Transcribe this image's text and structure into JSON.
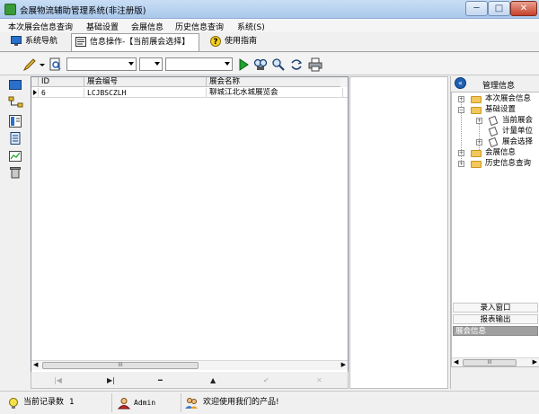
{
  "window": {
    "title": "会展物流辅助管理系统(非注册版)",
    "min": "─",
    "max": "□",
    "close": "✕"
  },
  "menu": [
    "本次展会信息查询",
    "基础设置",
    "会展信息",
    "历史信息查询",
    "系统(S)"
  ],
  "tabs": [
    {
      "label": "系统导航",
      "icon": "monitor-icon"
    },
    {
      "label": "信息操作-【当前展会选择】",
      "icon": "document-icon"
    },
    {
      "label": "使用指南",
      "icon": "help-icon"
    }
  ],
  "toolbar": {
    "icons": [
      "pencil-icon",
      "search-doc-icon",
      "play-icon",
      "find-icon",
      "find-next-icon",
      "replace-icon",
      "print-icon"
    ],
    "combo1": "",
    "combo2": "",
    "combo3": ""
  },
  "grid": {
    "columns": [
      "ID",
      "展会编号",
      "展会名称"
    ],
    "rows": [
      {
        "id": "6",
        "code": "LCJBSCZLH",
        "name": "聊城江北水城展览会"
      }
    ],
    "scroll_thumb": "III"
  },
  "pager": [
    "|◀",
    "▶|",
    "━",
    "▲",
    "✔",
    "✕"
  ],
  "right_panel": {
    "title": "管理信息",
    "tree": [
      {
        "label": "本次展会信息",
        "level": 0,
        "type": "folder",
        "exp": "+"
      },
      {
        "label": "基础设置",
        "level": 0,
        "type": "folder",
        "exp": "−"
      },
      {
        "label": "当前展会",
        "level": 1,
        "type": "doc",
        "exp": "+"
      },
      {
        "label": "计量单位",
        "level": 1,
        "type": "doc",
        "exp": ""
      },
      {
        "label": "展会选择",
        "level": 1,
        "type": "doc",
        "exp": "+"
      },
      {
        "label": "会展信息",
        "level": 0,
        "type": "folder",
        "exp": "+"
      },
      {
        "label": "历史信息查询",
        "level": 0,
        "type": "folder",
        "exp": "+"
      }
    ],
    "buttons": [
      "录入窗口",
      "报表输出",
      "展会信息"
    ],
    "scroll_thumb": "III"
  },
  "status": {
    "record_label": "当前记录数",
    "record_count": "1",
    "user": "Admin",
    "welcome": "欢迎使用我们的产品!"
  }
}
